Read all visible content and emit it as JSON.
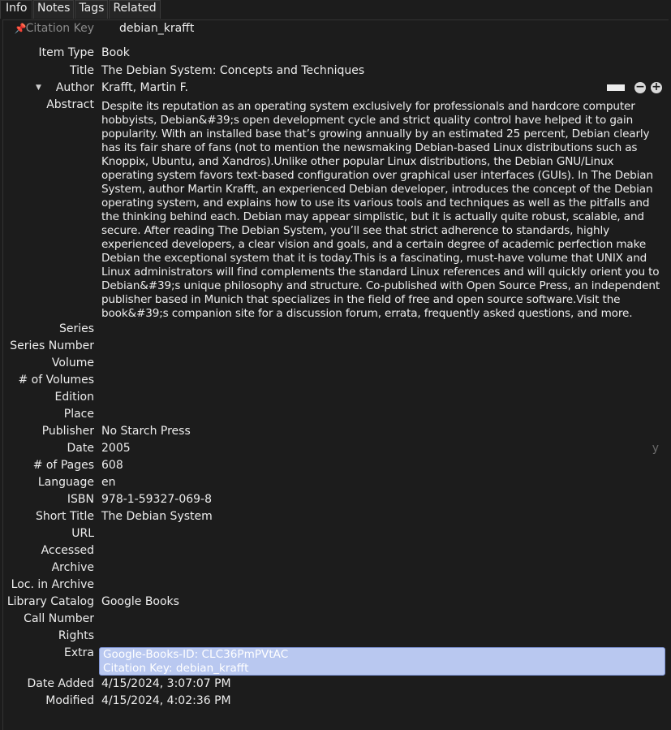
{
  "tabs": [
    "Info",
    "Notes",
    "Tags",
    "Related"
  ],
  "citation_key": {
    "label": "Citation Key",
    "value": "debian_krafft"
  },
  "fields": {
    "item_type": {
      "label": "Item Type",
      "value": "Book"
    },
    "title": {
      "label": "Title",
      "value": "The Debian System: Concepts and Techniques"
    },
    "author": {
      "label": "Author",
      "value": "Krafft, Martin F."
    },
    "abstract": {
      "label": "Abstract",
      "value": "Despite its reputation as an operating system exclusively for professionals and hardcore computer hobbyists, Debian&#39;s open development cycle and strict quality control have helped it to gain popularity. With an installed base that’s growing annually by an estimated 25 percent, Debian clearly has its fair share of fans (not to mention the newsmaking Debian-based Linux distributions such as Knoppix, Ubuntu, and Xandros).Unlike other popular Linux distributions, the Debian GNU/Linux operating system favors text-based configuration over graphical user interfaces (GUIs). In The Debian System, author Martin Krafft, an experienced Debian developer, introduces the concept of the Debian operating system, and explains how to use its various tools and techniques as well as the pitfalls and the thinking behind each. Debian may appear simplistic, but it is actually quite robust, scalable, and secure. After reading The Debian System, you’ll see that strict adherence to standards, highly experienced developers, a clear vision and goals, and a certain degree of academic perfection make Debian the exceptional system that it is today.This is a fascinating, must-have volume that UNIX and Linux administrators will find complements the standard Linux references and will quickly orient you to Debian&#39;s unique philosophy and structure. Co-published with Open Source Press, an independent publisher based in Munich that specializes in the field of free and open source software.Visit the book&#39;s companion site for a discussion forum, errata, frequently asked questions, and more."
    },
    "series": {
      "label": "Series",
      "value": ""
    },
    "series_number": {
      "label": "Series Number",
      "value": ""
    },
    "volume": {
      "label": "Volume",
      "value": ""
    },
    "num_volumes": {
      "label": "# of Volumes",
      "value": ""
    },
    "edition": {
      "label": "Edition",
      "value": ""
    },
    "place": {
      "label": "Place",
      "value": ""
    },
    "publisher": {
      "label": "Publisher",
      "value": "No Starch Press"
    },
    "date": {
      "label": "Date",
      "value": "2005",
      "format_hint": "y"
    },
    "num_pages": {
      "label": "# of Pages",
      "value": "608"
    },
    "language": {
      "label": "Language",
      "value": "en"
    },
    "isbn": {
      "label": "ISBN",
      "value": "978-1-59327-069-8"
    },
    "short_title": {
      "label": "Short Title",
      "value": "The Debian System"
    },
    "url": {
      "label": "URL",
      "value": ""
    },
    "accessed": {
      "label": "Accessed",
      "value": ""
    },
    "archive": {
      "label": "Archive",
      "value": ""
    },
    "loc_in_archive": {
      "label": "Loc. in Archive",
      "value": ""
    },
    "library_catalog": {
      "label": "Library Catalog",
      "value": "Google Books"
    },
    "call_number": {
      "label": "Call Number",
      "value": ""
    },
    "rights": {
      "label": "Rights",
      "value": ""
    },
    "extra": {
      "label": "Extra",
      "line1": "Google-Books-ID: CLC36PmPVtAC",
      "line2": "Citation Key: debian_krafft"
    },
    "date_added": {
      "label": "Date Added",
      "value": "4/15/2024, 3:07:07 PM"
    },
    "modified": {
      "label": "Modified",
      "value": "4/15/2024, 4:02:36 PM"
    }
  },
  "icons": {
    "pin": "pushpin-icon",
    "author_toggle": "triangle-down-icon",
    "creator_type": "dash-icon",
    "remove_creator": "minus-circle-icon",
    "add_creator": "plus-circle-icon"
  },
  "colors": {
    "background": "#1c1c1c",
    "text": "#ededed",
    "extra_highlight": "#b9c8f0",
    "pin": "#d9534f"
  }
}
